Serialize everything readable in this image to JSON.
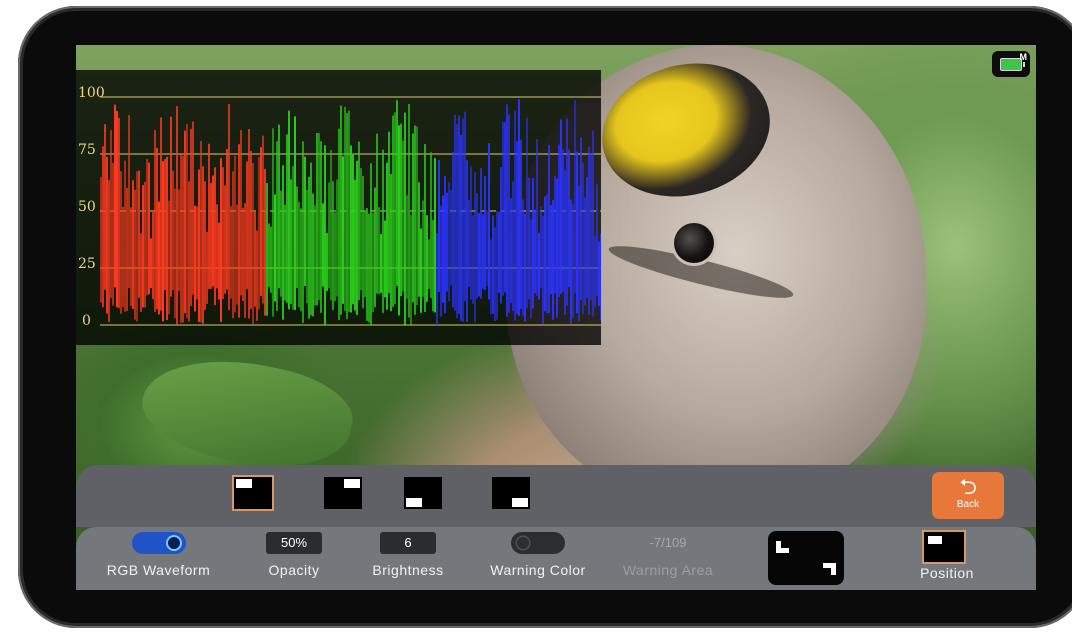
{
  "status": {
    "battery_icon": "battery-icon",
    "battery_mode": "M"
  },
  "waveform": {
    "scale_labels": [
      "100",
      "75",
      "50",
      "25",
      "0"
    ],
    "channels": [
      "red",
      "green",
      "blue"
    ],
    "colors": {
      "red": "#ff3a1f",
      "green": "#2bd11c",
      "blue": "#2a33ff",
      "grid": "#d8cf6a"
    }
  },
  "position_options": [
    {
      "id": "top-left",
      "selected": true
    },
    {
      "id": "top-right",
      "selected": false
    },
    {
      "id": "bottom-left",
      "selected": false
    },
    {
      "id": "bottom-right",
      "selected": false
    }
  ],
  "back_button": {
    "icon": "back-arrow-icon",
    "label": "Back",
    "color": "#e8773a"
  },
  "controls": {
    "rgb_waveform": {
      "label": "RGB Waveform",
      "state": "on"
    },
    "opacity": {
      "label": "Opacity",
      "value": "50%"
    },
    "brightness": {
      "label": "Brightness",
      "value": "6"
    },
    "warning_color": {
      "label": "Warning Color",
      "state": "off"
    },
    "warning_area": {
      "label": "Warning Area",
      "value": "-7/109"
    },
    "position": {
      "label": "Position",
      "value": "top-left"
    }
  }
}
